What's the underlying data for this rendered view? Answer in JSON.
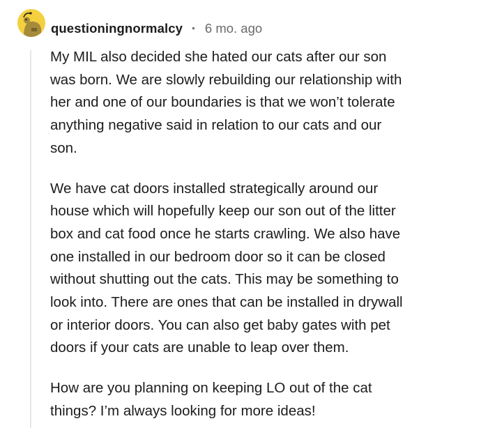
{
  "comment": {
    "username": "questioningnormalcy",
    "separator": "•",
    "timestamp": "6 mo. ago",
    "avatar_icon": "snoo-avatar-icon",
    "colors": {
      "avatar_bg": "#f4d03f",
      "thread_line": "#e4e6e8",
      "text": "#1c1c1c",
      "meta": "#6a6a6a"
    },
    "paragraphs": [
      {
        "lines": [
          "My MIL also decided she hated our cats after our son",
          "was born. We are slowly rebuilding our relationship with",
          "her and one of our boundaries is that we won’t tolerate",
          "anything negative said in relation to our cats and our",
          "son."
        ]
      },
      {
        "lines": [
          "We have cat doors installed strategically around our",
          "house which will hopefully keep our son out of the litter",
          "box and cat food once he starts crawling. We also have",
          "one installed in our bedroom door so it can be closed",
          "without shutting out the cats. This may be something to",
          "look into. There are ones that can be installed in drywall",
          "or interior doors. You can also get baby gates with pet",
          "doors if your cats are unable to leap over them."
        ]
      },
      {
        "lines": [
          "How are you planning on keeping LO out of the cat",
          "things? I’m always looking for more ideas!"
        ]
      }
    ]
  }
}
